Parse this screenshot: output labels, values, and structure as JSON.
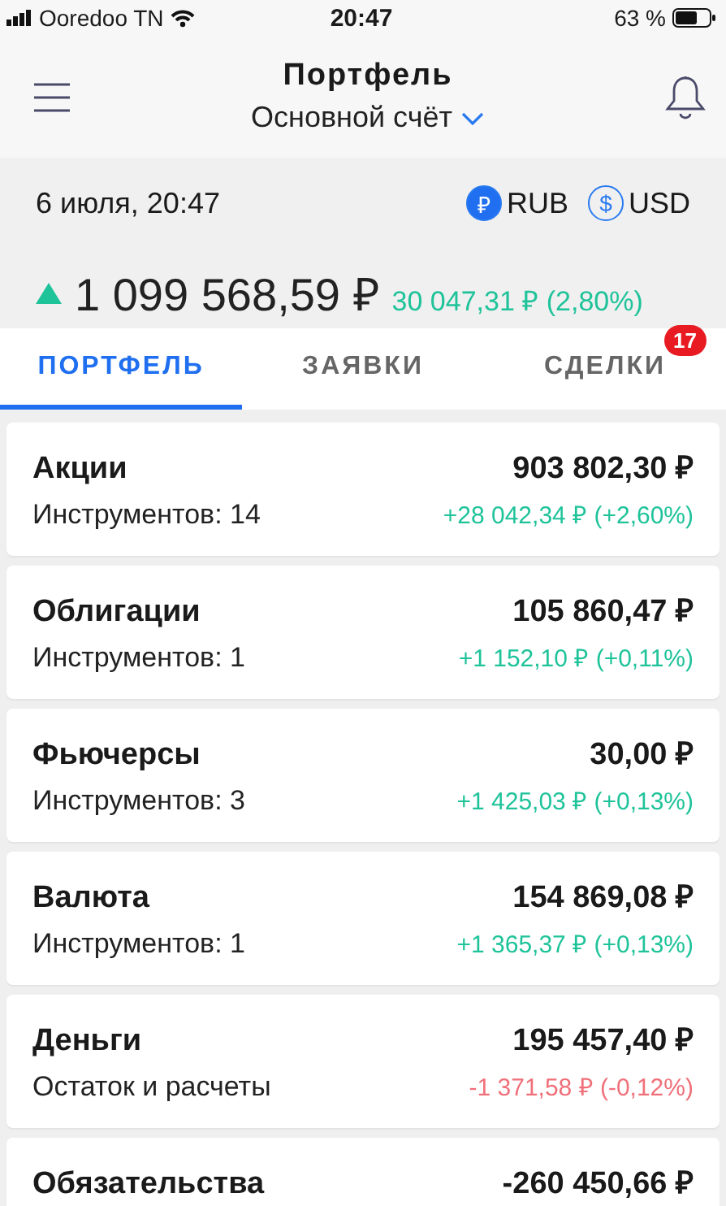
{
  "status_bar": {
    "carrier": "Ooredoo TN",
    "time": "20:47",
    "battery": "63 %"
  },
  "header": {
    "title": "Портфель",
    "account": "Основной счёт"
  },
  "summary": {
    "date": "6 июля, 20:47",
    "currencies": [
      {
        "symbol": "₽",
        "code": "RUB",
        "selected": true
      },
      {
        "symbol": "$",
        "code": "USD",
        "selected": false
      }
    ],
    "gain": true,
    "total": "1 099 568,59 ₽",
    "change": "30 047,31 ₽ (2,80%)"
  },
  "tabs": [
    {
      "label": "ПОРТФЕЛЬ",
      "selected": true
    },
    {
      "label": "ЗАЯВКИ",
      "selected": false
    },
    {
      "label": "СДЕЛКИ",
      "selected": false,
      "badge": "17"
    }
  ],
  "categories": [
    {
      "name": "Акции",
      "value": "903 802,30 ₽",
      "subtitle": "Инструментов: 14",
      "change": "+28 042,34 ₽ (+2,60%)",
      "gain": true
    },
    {
      "name": "Облигации",
      "value": "105 860,47 ₽",
      "subtitle": "Инструментов: 1",
      "change": "+1 152,10 ₽ (+0,11%)",
      "gain": true
    },
    {
      "name": "Фьючерсы",
      "value": "30,00 ₽",
      "subtitle": "Инструментов: 3",
      "change": "+1 425,03 ₽ (+0,13%)",
      "gain": true
    },
    {
      "name": "Валюта",
      "value": "154 869,08 ₽",
      "subtitle": "Инструментов: 1",
      "change": "+1 365,37 ₽ (+0,13%)",
      "gain": true
    },
    {
      "name": "Деньги",
      "value": "195 457,40 ₽",
      "subtitle": "Остаток и расчеты",
      "change": "-1 371,58 ₽ (-0,12%)",
      "gain": false
    },
    {
      "name": "Обязательства",
      "value": "-260 450,66 ₽"
    }
  ]
}
